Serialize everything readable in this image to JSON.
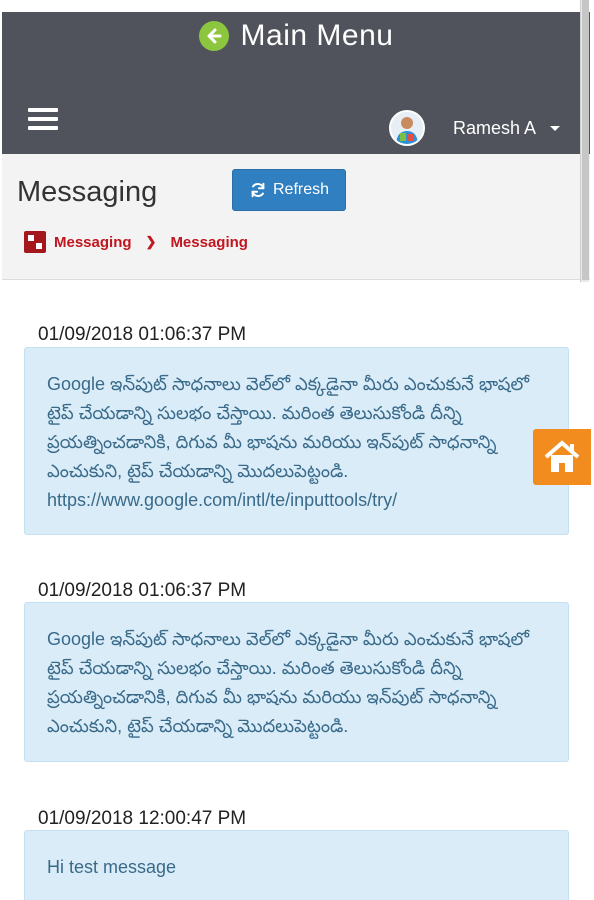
{
  "header": {
    "title": "Main Menu",
    "back_icon": "arrow-left-circle-icon",
    "menu_icon": "hamburger-icon",
    "user_name": "Ramesh A",
    "avatar_icon": "user-avatar-icon",
    "colors": {
      "bar": "#50535c",
      "back_icon": "#8cc63f",
      "text": "#ffffff"
    }
  },
  "page": {
    "title": "Messaging",
    "refresh_label": "Refresh",
    "refresh_icon": "refresh-icon",
    "breadcrumb": [
      "Messaging",
      "Messaging"
    ],
    "colors": {
      "refresh_bg": "#2f7fc1",
      "breadcrumb": "#c0161f"
    }
  },
  "messages": [
    {
      "time": "01/09/2018 01:06:37 PM",
      "text": "Google ఇన్‌పుట్ సాధనాలు వెల్‌లో ఎక్కడైనా మీరు ఎంచుకునే భాషలో టైప్ చేయడాన్ని సులభం చేస్తాయి. మరింత తెలుసుకోండి దీన్ని ప్రయత్నించడానికి, దిగువ మీ భాషను మరియు ఇన్‌పుట్ సాధనాన్ని ఎంచుకుని, టైప్ చేయడాన్ని మొదలుపెట్టండి. https://www.google.com/intl/te/inputtools/try/"
    },
    {
      "time": "01/09/2018 01:06:37 PM",
      "text": "Google ఇన్‌పుట్ సాధనాలు వెల్‌లో ఎక్కడైనా మీరు ఎంచుకునే భాషలో టైప్ చేయడాన్ని సులభం చేస్తాయి. మరింత తెలుసుకోండి దీన్ని ప్రయత్నించడానికి, దిగువ మీ భాషను మరియు ఇన్‌పుట్ సాధనాన్ని ఎంచుకుని, టైప్ చేయడాన్ని మొదలుపెట్టండి."
    },
    {
      "time": "01/09/2018 12:00:47 PM",
      "text": "Hi test message"
    }
  ],
  "floating": {
    "home_icon": "home-icon",
    "color": "#f28c1e"
  }
}
